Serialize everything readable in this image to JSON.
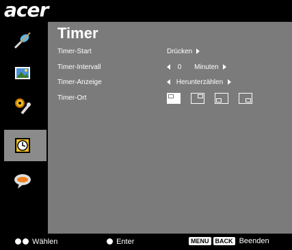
{
  "brand": {
    "logo_text": "acer"
  },
  "sidebar": {
    "items": [
      {
        "icon": "wrench-brush-icon"
      },
      {
        "icon": "picture-icon"
      },
      {
        "icon": "gears-icon"
      },
      {
        "icon": "timer-clock-icon",
        "active": true
      },
      {
        "icon": "language-bubble-icon"
      }
    ]
  },
  "panel": {
    "title": "Timer",
    "rows": [
      {
        "label": "Timer-Start",
        "value": "Drücken"
      },
      {
        "label": "Timer-Intervall",
        "value": "0",
        "unit": "Minuten"
      },
      {
        "label": "Timer-Anzeige",
        "value": "Herunterzählen"
      },
      {
        "label": "Timer-Ort",
        "positions": [
          "top-left",
          "top-right",
          "bottom-left",
          "bottom-right"
        ],
        "selected": "top-left"
      }
    ]
  },
  "bottom": {
    "select_label": "Wählen",
    "enter_label": "Enter",
    "menu_key": "MENU",
    "back_key": "BACK",
    "exit_label": "Beenden"
  },
  "colors": {
    "panel_bg": "#7b7b7b",
    "active_bg": "#8b8b8b",
    "background": "#000000"
  }
}
